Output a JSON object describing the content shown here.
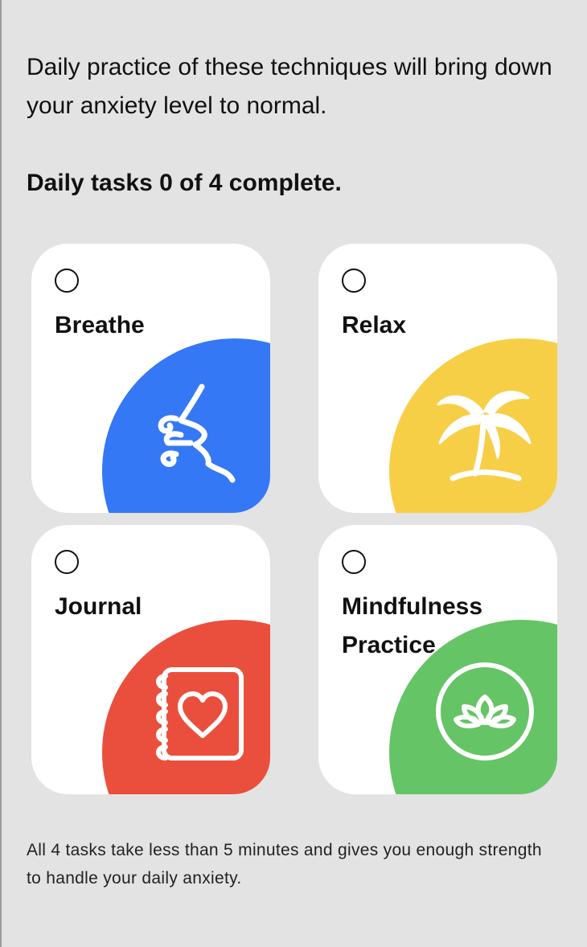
{
  "intro_text": "Daily practice of these techniques will bring down your anxiety level to normal.",
  "progress_text": "Daily tasks 0 of 4 complete.",
  "tasks": [
    {
      "label": "Breathe",
      "completed": false,
      "color": "#3478f6",
      "icon": "breathe-icon"
    },
    {
      "label": "Relax",
      "completed": false,
      "color": "#f7cf47",
      "icon": "palm-tree-icon"
    },
    {
      "label": "Journal",
      "completed": false,
      "color": "#ea4f3d",
      "icon": "journal-heart-icon"
    },
    {
      "label": "Mindfulness Practice",
      "completed": false,
      "color": "#65c466",
      "icon": "lotus-icon"
    }
  ],
  "footer_text": "All 4 tasks take less than 5 minutes and gives you enough strength to handle your daily anxiety."
}
